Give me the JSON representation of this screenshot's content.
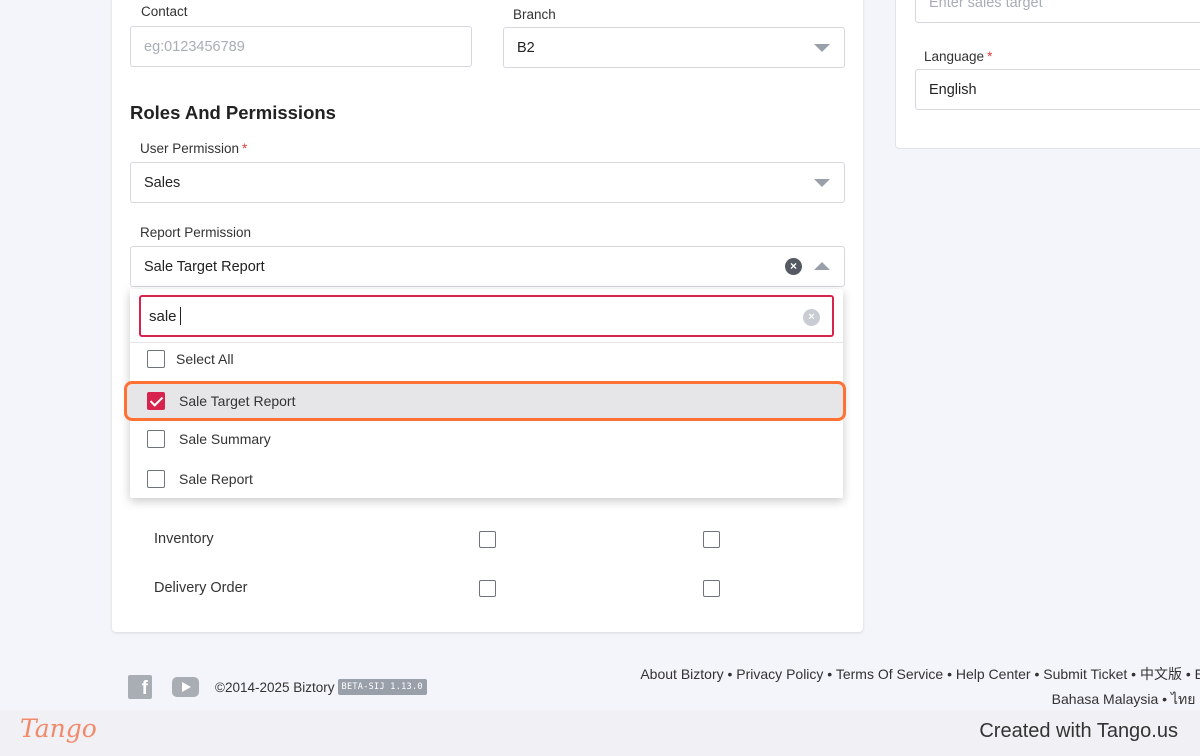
{
  "contact": {
    "label": "Contact",
    "placeholder": "eg:0123456789"
  },
  "branch": {
    "label": "Branch",
    "value": "B2"
  },
  "side_panel": {
    "sales_target_placeholder": "Enter sales target",
    "language_label": "Language",
    "language_value": "English"
  },
  "roles_section": {
    "title": "Roles And Permissions"
  },
  "user_permission": {
    "label": "User Permission",
    "value": "Sales"
  },
  "report_permission": {
    "label": "Report Permission",
    "value": "Sale Target Report"
  },
  "dropdown": {
    "search_value": "sale",
    "options": [
      {
        "label": "Select All",
        "checked": false
      },
      {
        "label": "Sale Target Report",
        "checked": true
      },
      {
        "label": "Sale Summary",
        "checked": false
      },
      {
        "label": "Sale Report",
        "checked": false
      }
    ]
  },
  "permission_rows": [
    {
      "label": "Inventory"
    },
    {
      "label": "Delivery Order"
    }
  ],
  "footer": {
    "links_line1": "About Biztory • Privacy Policy • Terms Of Service • Help Center • Submit Ticket • 中文版 • E",
    "links_line2": "Bahasa Malaysia • ไทย (",
    "copyright": "©2014-2025 Biztory",
    "version_badge": "BETA-SIJ 1.13.0",
    "facebook_glyph": "f"
  },
  "tango": {
    "logo": "Tango",
    "created": "Created with Tango.us"
  },
  "colors": {
    "accent": "#d6244d",
    "highlight": "#ff7234"
  }
}
